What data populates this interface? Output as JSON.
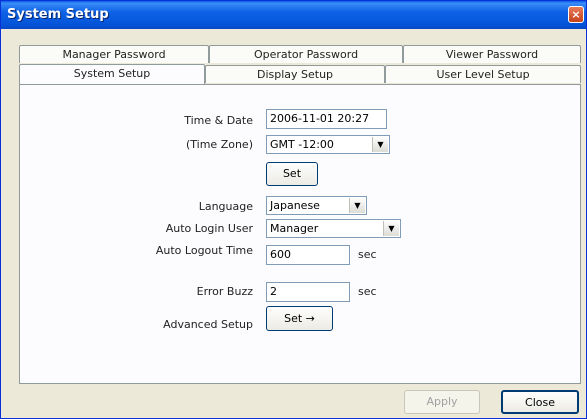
{
  "window": {
    "title": "System Setup",
    "close_glyph": "×"
  },
  "tabs_back": [
    "Manager Password",
    "Operator Password",
    "Viewer Password"
  ],
  "tabs_front": [
    "System Setup",
    "Display Setup",
    "User Level Setup"
  ],
  "form": {
    "time_date_label": "Time & Date",
    "time_date_value": "2006-11-01 20:27",
    "time_zone_label": "(Time Zone)",
    "time_zone_value": "GMT -12:00",
    "set_label": "Set",
    "language_label": "Language",
    "language_value": "Japanese",
    "auto_login_label": "Auto Login User",
    "auto_login_value": "Manager",
    "auto_logout_label": "Auto Logout Time",
    "auto_logout_value": "600",
    "auto_logout_unit": "sec",
    "error_buzz_label": "Error Buzz",
    "error_buzz_value": "2",
    "error_buzz_unit": "sec",
    "advanced_label": "Advanced Setup",
    "advanced_btn": "Set →"
  },
  "footer": {
    "apply": "Apply",
    "close": "Close"
  },
  "icons": {
    "dropdown": "▼"
  }
}
